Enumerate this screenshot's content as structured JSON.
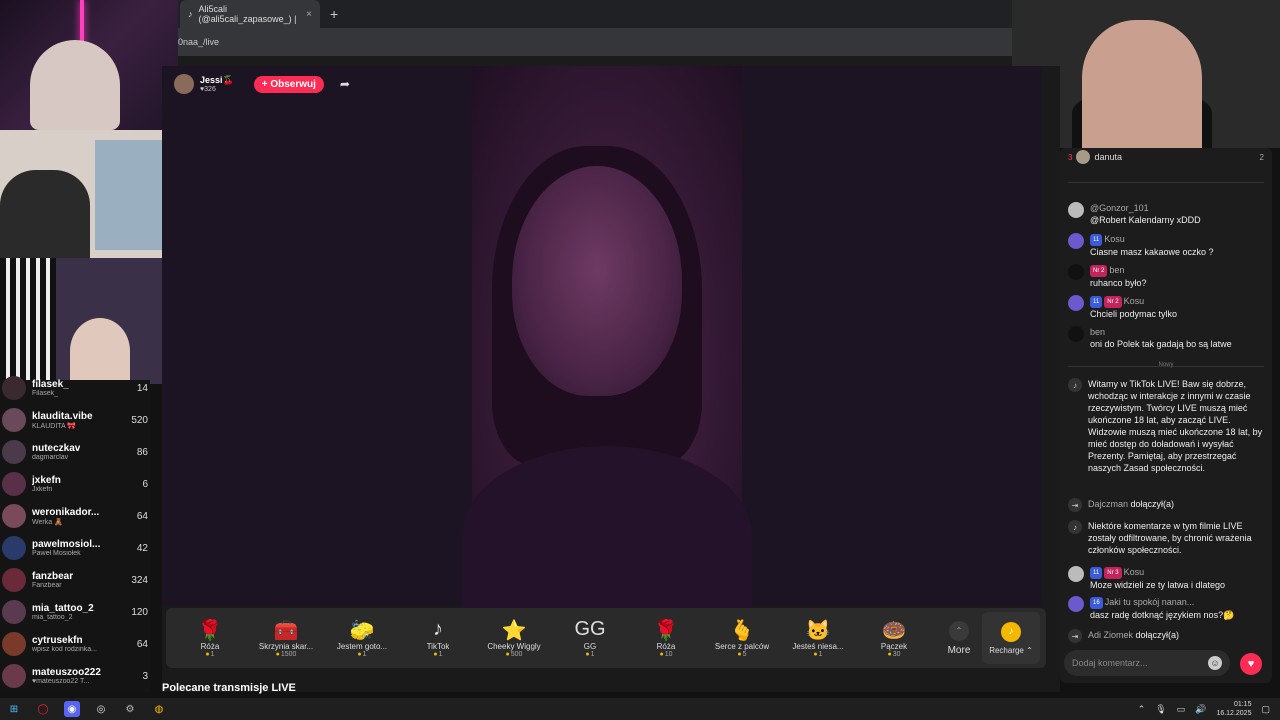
{
  "browser": {
    "tab_title": "Ali5cali (@ali5cali_zapasowe_) |",
    "tab_close": "×",
    "new_tab": "+",
    "url": "0naa_/live"
  },
  "stream": {
    "host_name": "Jessi🍒",
    "host_likes": "♥326",
    "follow_label": "+ Obserwuj",
    "share_icon": "share-icon",
    "recommended_label": "Polecane transmisje LIVE"
  },
  "gifts": [
    {
      "name": "Róża",
      "price": "1",
      "glyph": "🌹"
    },
    {
      "name": "Skrzynia skar...",
      "price": "1500",
      "glyph": "🧰"
    },
    {
      "name": "Jestem goto...",
      "price": "1",
      "glyph": "🧽"
    },
    {
      "name": "TikTok",
      "price": "1",
      "glyph": "♪"
    },
    {
      "name": "Cheeky Wiggly",
      "price": "500",
      "glyph": "⭐"
    },
    {
      "name": "GG",
      "price": "1",
      "glyph": "GG"
    },
    {
      "name": "Róża",
      "price": "10",
      "glyph": "🌹"
    },
    {
      "name": "Serce z palców",
      "price": "5",
      "glyph": "🫰"
    },
    {
      "name": "Jesteś niesa...",
      "price": "1",
      "glyph": "🐱"
    },
    {
      "name": "Pączek",
      "price": "30",
      "glyph": "🍩"
    }
  ],
  "gift_bar": {
    "more_label": "More",
    "recharge_label": "Recharge ⌃"
  },
  "chat": {
    "top_viewer": {
      "rank": "3",
      "name": "danuta",
      "count": "2"
    },
    "separator_new": "Nowy",
    "messages": [
      {
        "user": "@Gonzor_101",
        "badges": [],
        "text": "@Robert Kalendarny xDDD"
      },
      {
        "user": "Kosu",
        "badges": [
          {
            "t": "11",
            "c": "blue"
          }
        ],
        "text": "Ciasne masz kakaowe oczko ?"
      },
      {
        "user": "ben",
        "badges": [
          {
            "t": "Nr 2",
            "c": "red"
          }
        ],
        "text": "ruhanco było?"
      },
      {
        "user": "Kosu",
        "badges": [
          {
            "t": "11",
            "c": "blue"
          },
          {
            "t": "Nr 2",
            "c": "red"
          }
        ],
        "text": "Chcieli podymac tylko"
      },
      {
        "user": "ben",
        "badges": [],
        "text": "oni do Polek tak gadają bo są latwe"
      }
    ],
    "system_welcome": "Witamy w TikTok LIVE! Baw się dobrze, wchodząc w interakcje z innymi w czasie rzeczywistym. Twórcy LIVE muszą mieć ukończone 18 lat, aby zacząć LIVE. Widzowie muszą mieć ukończone 18 lat, by mieć dostęp do doładowań i wysyłać Prezenty. Pamiętaj, aby przestrzegać naszych Zasad społeczności.",
    "join1": {
      "user": "Dajczman",
      "text": "dołączył(a)"
    },
    "system_filter": "Niektóre komentarze w tym filmie LIVE zostały odfiltrowane, by chronić wrażenia członków społeczności.",
    "messages2": [
      {
        "user": "Kosu",
        "badges": [
          {
            "t": "11",
            "c": "blue"
          },
          {
            "t": "Nr 3",
            "c": "red"
          }
        ],
        "text": "Moze widzieli ze ty latwa i dlatego"
      },
      {
        "user": "Jaki tu spokój nanan...",
        "badges": [
          {
            "t": "16",
            "c": "blue"
          }
        ],
        "text": "dasz radę dotknąć językiem nos?🤔"
      }
    ],
    "join2": {
      "user": "Adi Ziomek",
      "text": "dołączył(a)"
    },
    "input_placeholder": "Dodaj komentarz..."
  },
  "leaderboard": [
    {
      "name": "filasek_",
      "sub": "Filasek_",
      "score": "14"
    },
    {
      "name": "klaudita.vibe",
      "sub": "KLAUDITA 🎀",
      "score": "520"
    },
    {
      "name": "nuteczkav",
      "sub": "dagmarclav",
      "score": "86"
    },
    {
      "name": "jxkefn",
      "sub": "Jxkefn",
      "score": "6"
    },
    {
      "name": "weronikador...",
      "sub": "Werka 🧸",
      "score": "64"
    },
    {
      "name": "pawelmosiol...",
      "sub": "Paweł Mosiołek",
      "score": "42"
    },
    {
      "name": "fanzbear",
      "sub": "Fanzbear",
      "score": "324"
    },
    {
      "name": "mia_tattoo_2",
      "sub": "mia_tattoo_2",
      "score": "120"
    },
    {
      "name": "cytrusekfn",
      "sub": "wpisz kod rodzinka...",
      "score": "64"
    },
    {
      "name": "mateuszoo222",
      "sub": "♥mateuszoo22 T...",
      "score": "3"
    }
  ],
  "taskbar": {
    "time": "01:15",
    "date": "16.12.2025"
  }
}
